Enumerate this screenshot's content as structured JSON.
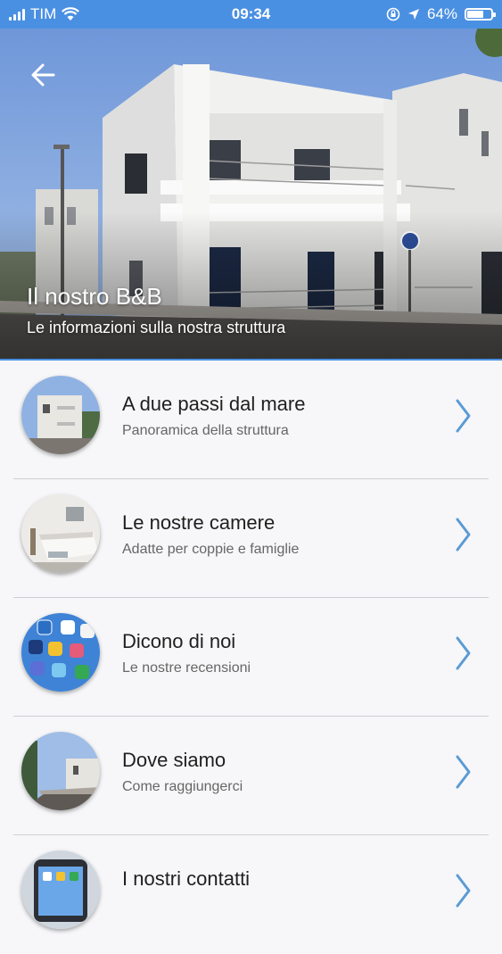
{
  "status_bar": {
    "carrier": "TIM",
    "time": "09:34",
    "battery_percent": "64%",
    "battery_level": 0.64,
    "icons": [
      "signal-bars-icon",
      "wifi-icon",
      "orientation-lock-icon",
      "location-arrow-icon",
      "battery-icon"
    ]
  },
  "hero": {
    "title": "Il nostro B&B",
    "subtitle": "Le informazioni sulla nostra struttura",
    "back_icon": "back-arrow-icon"
  },
  "colors": {
    "accent": "#4a90e2",
    "background": "#f7f7f9",
    "chevron": "#5b9bd5",
    "separator": "#cfcfd3"
  },
  "menu": {
    "items": [
      {
        "title": "A due passi dal mare",
        "subtitle": "Panoramica della struttura"
      },
      {
        "title": "Le nostre camere",
        "subtitle": "Adatte per coppie e famiglie"
      },
      {
        "title": "Dicono di noi",
        "subtitle": "Le nostre recensioni"
      },
      {
        "title": "Dove siamo",
        "subtitle": "Come raggiungerci"
      },
      {
        "title": "I nostri contatti",
        "subtitle": ""
      }
    ]
  }
}
